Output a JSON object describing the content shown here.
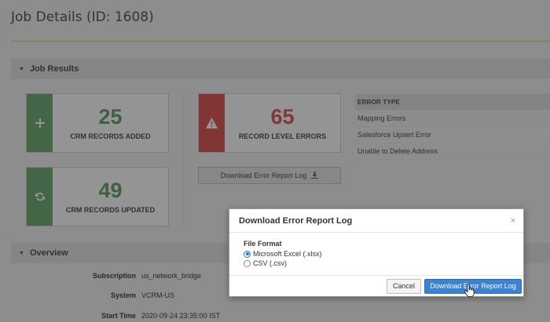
{
  "page": {
    "title": "Job Details (ID: 1608)"
  },
  "sections": {
    "job_results": "Job Results",
    "overview": "Overview"
  },
  "stats": {
    "added": {
      "value": "25",
      "label": "CRM RECORDS ADDED",
      "icon": "plus-icon"
    },
    "updated": {
      "value": "49",
      "label": "CRM RECORDS UPDATED",
      "icon": "refresh-icon"
    },
    "errors": {
      "value": "65",
      "label": "RECORD LEVEL ERRORS",
      "icon": "warning-icon"
    }
  },
  "download_button": {
    "label": "Download Error Report Log",
    "icon": "download-icon"
  },
  "error_table": {
    "header": "ERROR TYPE",
    "rows": [
      "Mapping Errors",
      "Salesforce Upsert Error",
      "Unable to Delete Address"
    ]
  },
  "overview": {
    "rows": [
      {
        "label": "Subscription",
        "value": "us_network_bridge"
      },
      {
        "label": "System",
        "value": "VCRM-US"
      },
      {
        "label": "Start Time",
        "value": "2020-09-24 23:35:00 IST"
      }
    ]
  },
  "modal": {
    "title": "Download Error Report Log",
    "close": "×",
    "file_format_label": "File Format",
    "options": [
      {
        "label": "Microsoft Excel (.xlsx)",
        "checked": true
      },
      {
        "label": "CSV (.csv)",
        "checked": false
      }
    ],
    "cancel_label": "Cancel",
    "confirm_label": "Download Error Report Log"
  },
  "colors": {
    "green": "#74b07a",
    "red": "#df5e5e",
    "primary": "#3c82d1",
    "title_rule": "#d8c67a"
  }
}
